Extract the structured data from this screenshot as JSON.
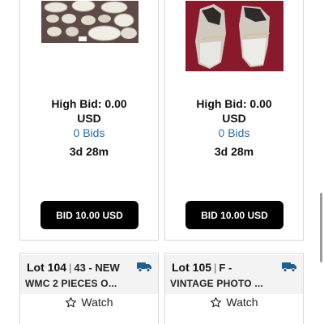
{
  "cards_top": [
    {
      "image_alt": "china dishes set",
      "high_bid_label": "High Bid: 0.00",
      "currency": "USD",
      "bids_label": "0 Bids",
      "time_left": "3d 28m",
      "bid_button_label": "BID 10.00 USD"
    },
    {
      "image_alt": "vintage shoes",
      "high_bid_label": "High Bid: 0.00",
      "currency": "USD",
      "bids_label": "0 Bids",
      "time_left": "3d 28m",
      "bid_button_label": "BID 10.00 USD"
    }
  ],
  "cards_bottom": [
    {
      "lot_number": "Lot 104",
      "lot_code": "43 - NEW",
      "title_line2": "WMC 2 PIECES O...",
      "watch_label": "Watch"
    },
    {
      "lot_number": "Lot 105",
      "lot_code": "F -",
      "title_line2": "VINTAGE PHOTO ...",
      "watch_label": "Watch"
    }
  ],
  "colors": {
    "link": "#2a6ea6",
    "button_bg": "#000000",
    "button_text": "#ffffff",
    "truck_icon": "#1f5f8f"
  },
  "icons": {
    "shipping": "truck-icon",
    "watch": "star-outline-icon"
  }
}
